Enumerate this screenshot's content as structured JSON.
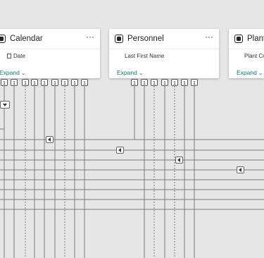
{
  "cards": [
    {
      "title": "Calendar",
      "field": "Date",
      "expand_label": "Expand",
      "more": "···"
    },
    {
      "title": "Personnel",
      "field": "Last First Name",
      "expand_label": "Expand",
      "more": "···"
    },
    {
      "title": "Plant",
      "field": "Plant Co",
      "expand_label": "Expand",
      "more": ""
    }
  ],
  "cardinality_label": "1",
  "colors": {
    "canvas": "#e6e6e6",
    "line": "#7a7a7a",
    "accent": "#117865"
  }
}
